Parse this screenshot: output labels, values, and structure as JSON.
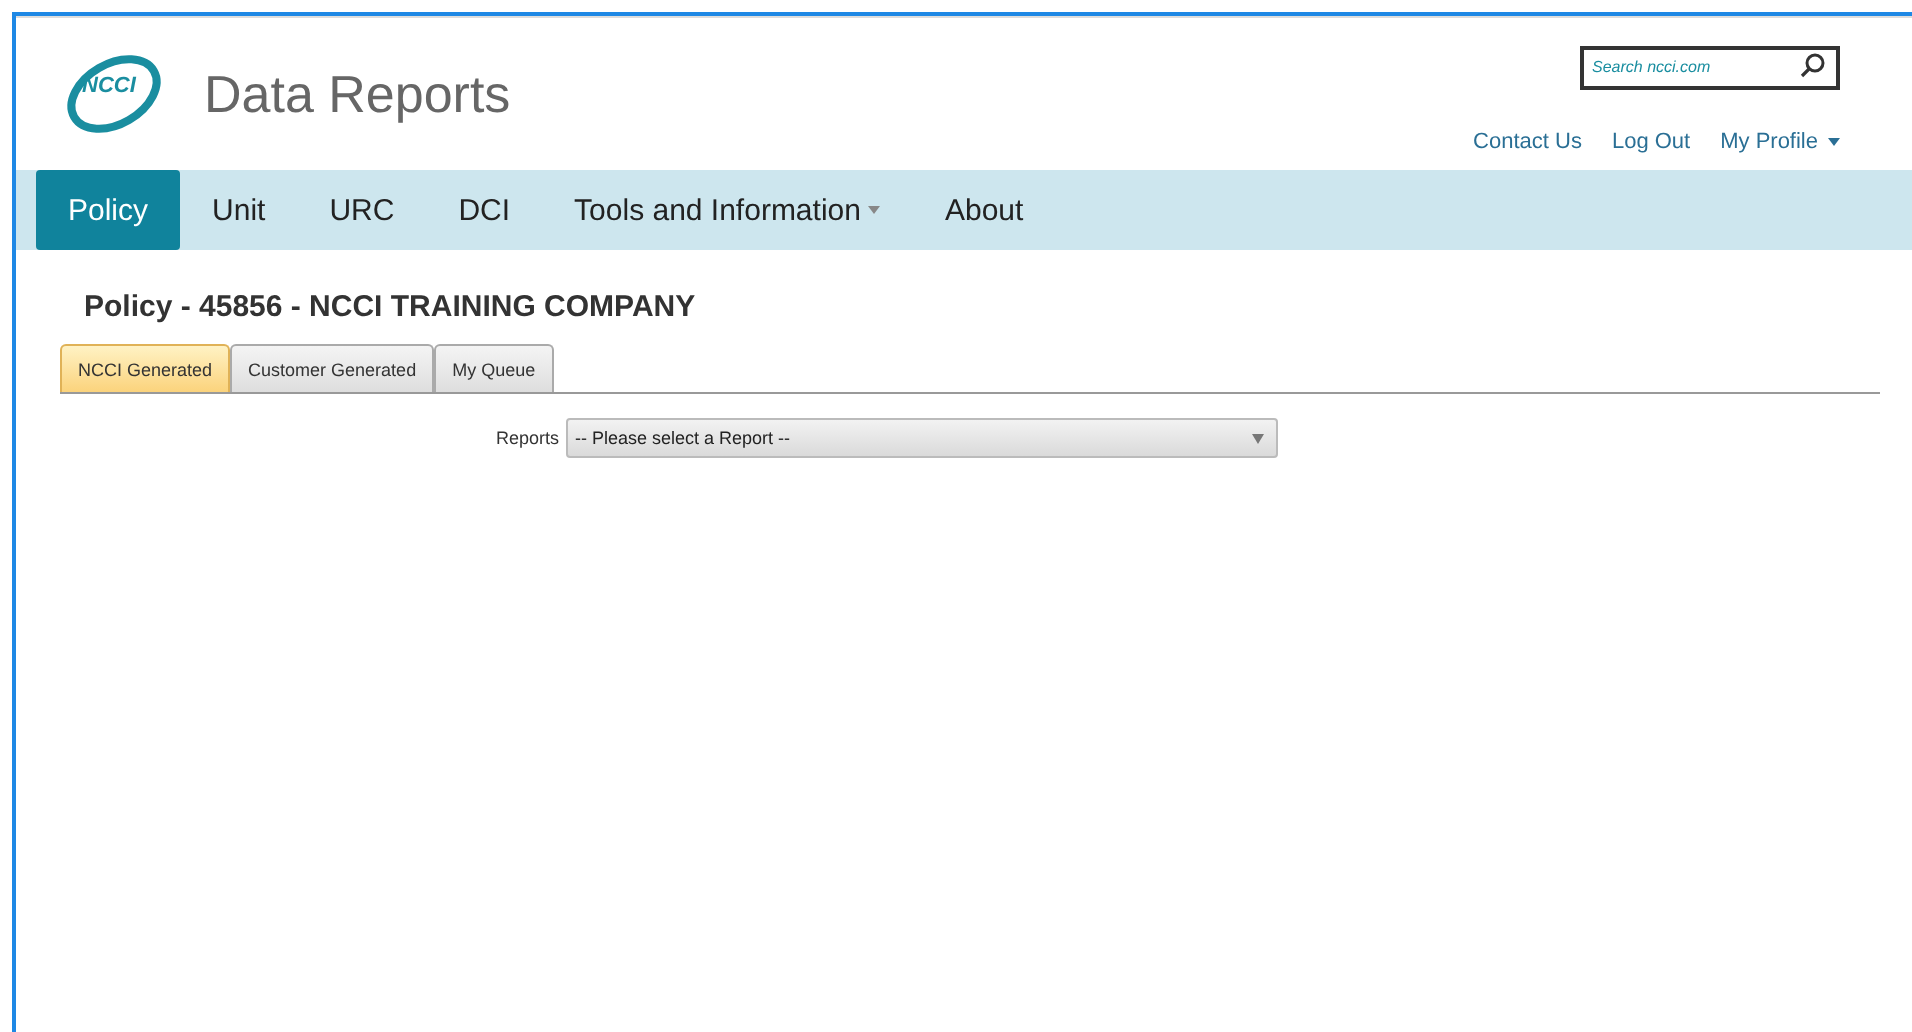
{
  "header": {
    "logo_text": "NCCI",
    "title": "Data Reports",
    "search": {
      "placeholder": "Search ncci.com"
    },
    "links": [
      {
        "label": "Contact Us",
        "dropdown": false
      },
      {
        "label": "Log Out",
        "dropdown": false
      },
      {
        "label": "My Profile",
        "dropdown": true
      }
    ]
  },
  "nav": [
    {
      "label": "Policy",
      "selected": true,
      "dropdown": false
    },
    {
      "label": "Unit",
      "selected": false,
      "dropdown": false
    },
    {
      "label": "URC",
      "selected": false,
      "dropdown": false
    },
    {
      "label": "DCI",
      "selected": false,
      "dropdown": false
    },
    {
      "label": "Tools and Information",
      "selected": false,
      "dropdown": true
    },
    {
      "label": "About",
      "selected": false,
      "dropdown": false
    }
  ],
  "page_title": "Policy - 45856 - NCCI TRAINING COMPANY",
  "tabs": [
    {
      "label": "NCCI Generated",
      "selected": true
    },
    {
      "label": "Customer Generated",
      "selected": false
    },
    {
      "label": "My Queue",
      "selected": false
    }
  ],
  "reports": {
    "label": "Reports",
    "value": "-- Please select a Report --"
  }
}
